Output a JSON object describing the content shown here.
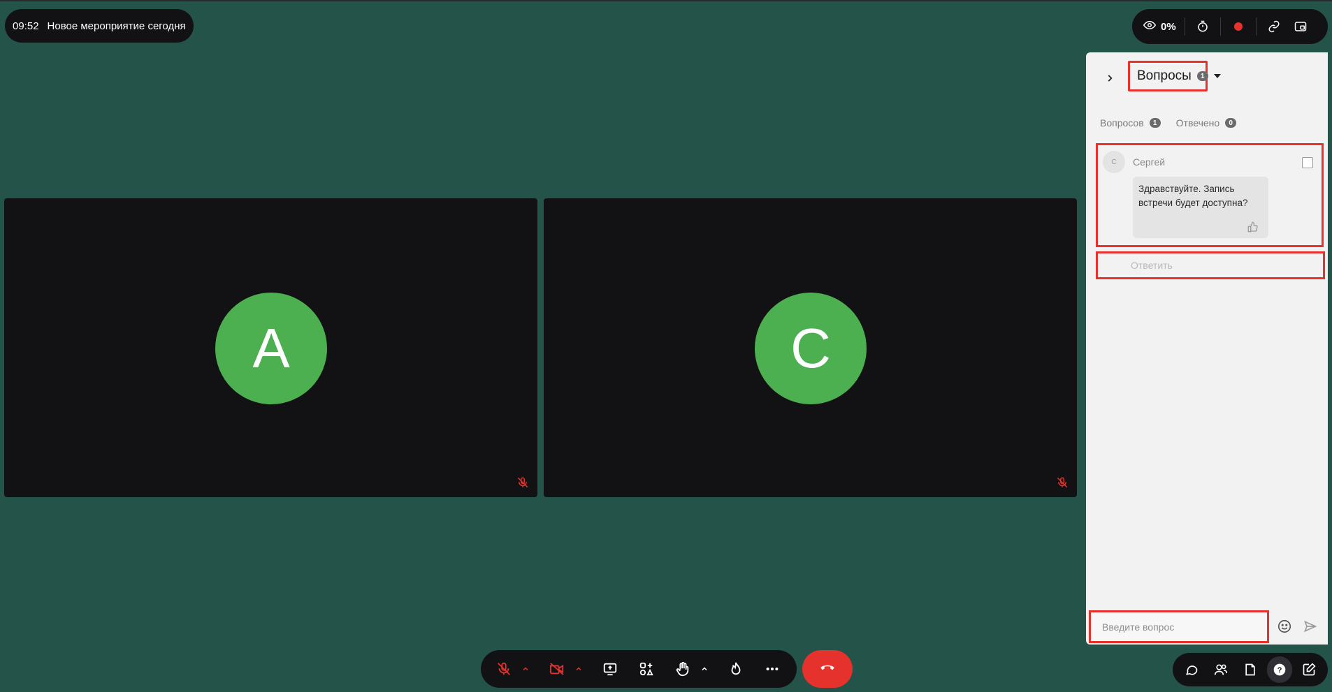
{
  "meeting": {
    "time": "09:52",
    "title": "Новое мероприятие сегодня"
  },
  "top_bar": {
    "views_percent": "0%",
    "icons": [
      "eye-icon",
      "timer-icon",
      "record-icon",
      "link-icon",
      "picture-in-picture-icon"
    ],
    "record_color": "#e5322d"
  },
  "tiles": [
    {
      "initial": "A",
      "muted": true
    },
    {
      "initial": "C",
      "muted": true
    }
  ],
  "colors": {
    "background": "#24534a",
    "avatar": "#4caf50",
    "highlight": "#e5322d",
    "tile": "#121215"
  },
  "panel": {
    "title": "Вопросы",
    "title_count": "1",
    "tabs": [
      {
        "label": "Вопросов",
        "count": "1"
      },
      {
        "label": "Отвечено",
        "count": "0"
      }
    ],
    "question": {
      "author_initial": "С",
      "author": "Сергей",
      "text": "Здравствуйте. Запись встречи будет доступна?"
    },
    "reply_label": "Ответить",
    "input_placeholder": "Введите вопрос"
  },
  "bottom_bar": {
    "icons": [
      "mic-off-icon",
      "camera-off-icon",
      "screen-share-icon",
      "apps-icon",
      "raise-hand-icon",
      "reaction-icon",
      "more-icon"
    ],
    "end_call_icon": "end-call-icon"
  },
  "bottom_right_bar": {
    "icons": [
      "chat-icon",
      "participants-icon",
      "notes-icon",
      "questions-icon",
      "edit-icon"
    ],
    "active": "questions-icon"
  }
}
